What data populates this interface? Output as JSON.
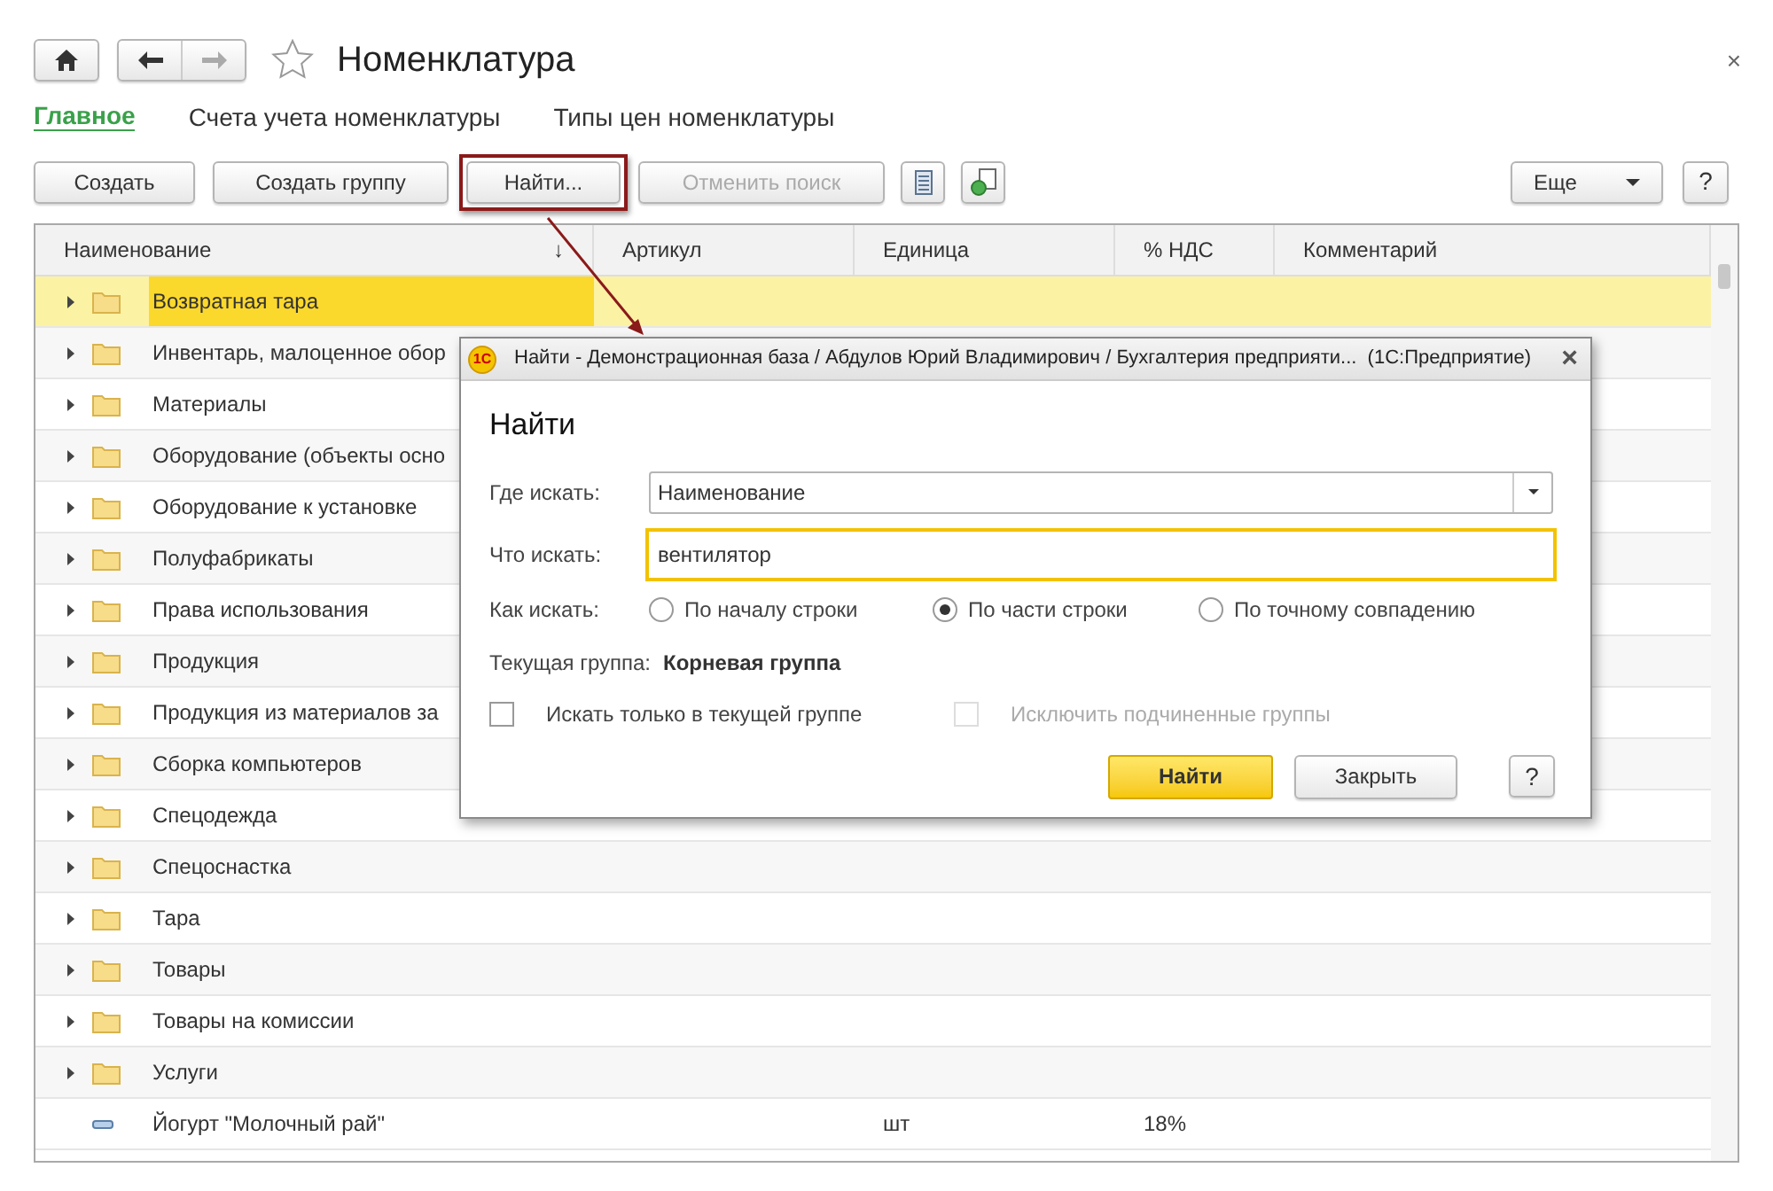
{
  "window": {
    "title": "Номенклатура",
    "close": "×"
  },
  "tabs": [
    {
      "label": "Главное",
      "selected": true
    },
    {
      "label": "Счета учета номенклатуры",
      "selected": false
    },
    {
      "label": "Типы цен номенклатуры",
      "selected": false
    }
  ],
  "toolbar": {
    "create": "Создать",
    "create_group": "Создать группу",
    "find": {
      "label": "Найти...",
      "highlighted": true
    },
    "cancel_search": {
      "label": "Отменить поиск",
      "disabled": true
    },
    "more": "Еще",
    "help": "?"
  },
  "table": {
    "columns": [
      {
        "label": "Наименование",
        "sort": "↓"
      },
      {
        "label": "Артикул"
      },
      {
        "label": "Единица"
      },
      {
        "label": "% НДС"
      },
      {
        "label": "Комментарий"
      }
    ],
    "rows": [
      {
        "kind": "group",
        "name": "Возвратная тара",
        "selected": true
      },
      {
        "kind": "group",
        "name": "Инвентарь, малоценное обор",
        "selected": false
      },
      {
        "kind": "group",
        "name": "Материалы",
        "selected": false
      },
      {
        "kind": "group",
        "name": "Оборудование (объекты осно",
        "selected": false
      },
      {
        "kind": "group",
        "name": "Оборудование к установке",
        "selected": false
      },
      {
        "kind": "group",
        "name": "Полуфабрикаты",
        "selected": false
      },
      {
        "kind": "group",
        "name": "Права использования",
        "selected": false
      },
      {
        "kind": "group",
        "name": "Продукция",
        "selected": false
      },
      {
        "kind": "group",
        "name": "Продукция из материалов за",
        "selected": false
      },
      {
        "kind": "group",
        "name": "Сборка компьютеров",
        "selected": false
      },
      {
        "kind": "group",
        "name": "Спецодежда",
        "selected": false
      },
      {
        "kind": "group",
        "name": "Спецоснастка",
        "selected": false
      },
      {
        "kind": "group",
        "name": "Тара",
        "selected": false
      },
      {
        "kind": "group",
        "name": "Товары",
        "selected": false
      },
      {
        "kind": "group",
        "name": "Товары на комиссии",
        "selected": false
      },
      {
        "kind": "group",
        "name": "Услуги",
        "selected": false
      },
      {
        "kind": "item",
        "name": "Йогурт \"Молочный рай\"",
        "unit": "шт",
        "vat": "18%",
        "selected": false
      }
    ]
  },
  "dialog": {
    "title": "Найти - Демонстрационная база / Абдулов Юрий Владимирович / Бухгалтерия предприяти...  (1С:Предприятие)",
    "app_badge": "1С",
    "close": "×",
    "heading": "Найти",
    "where_label": "Где искать:",
    "where_value": "Наименование",
    "what_label": "Что искать:",
    "what_value": "вентилятор",
    "how_label": "Как искать:",
    "how_options": [
      {
        "label": "По началу строки",
        "selected": false
      },
      {
        "label": "По части строки",
        "selected": true
      },
      {
        "label": "По точному совпадению",
        "selected": false
      }
    ],
    "group_label": "Текущая группа:",
    "group_value": "Корневая группа",
    "checks": [
      {
        "label": "Искать только в текущей группе",
        "checked": false,
        "disabled": false
      },
      {
        "label": "Исключить подчиненные группы",
        "checked": false,
        "disabled": true
      }
    ],
    "find_button": "Найти",
    "close_button": "Закрыть",
    "help": "?"
  }
}
